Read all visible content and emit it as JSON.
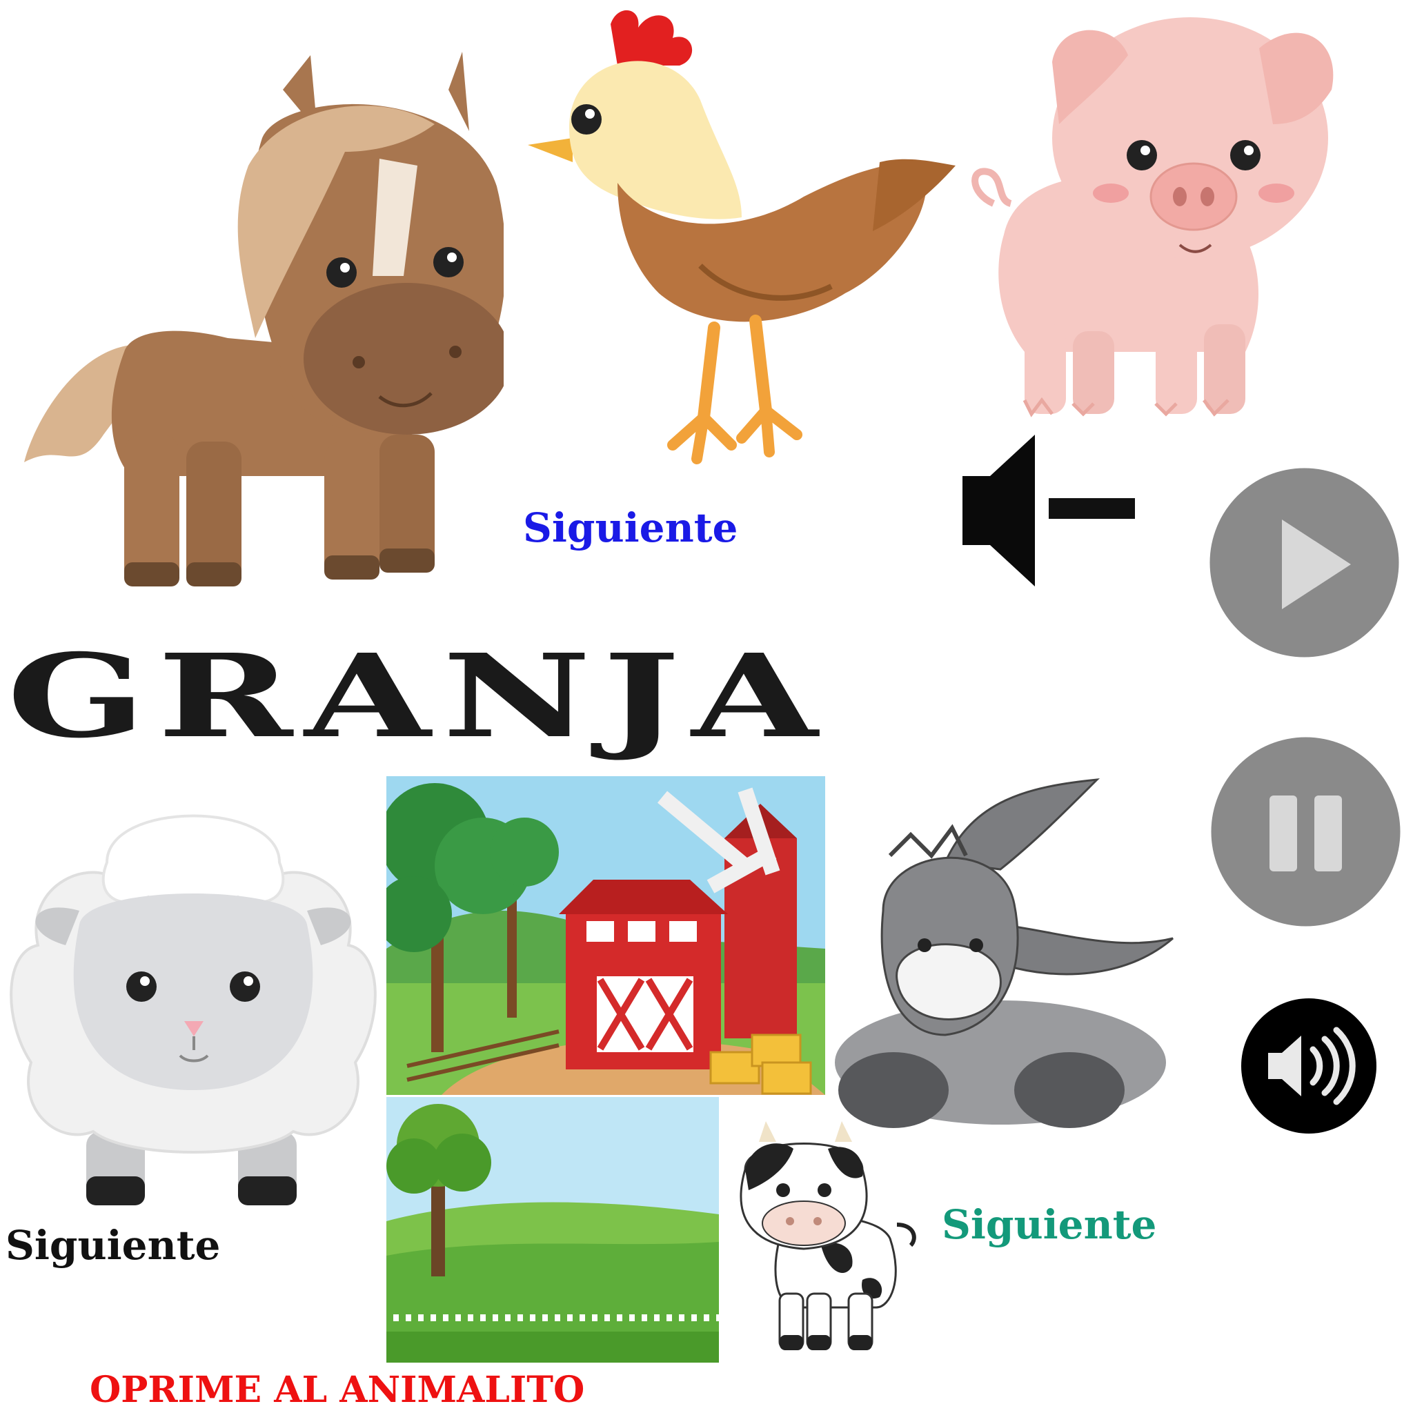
{
  "title": "GRANJA",
  "prompt": "OPRIME AL ANIMALITO",
  "next_buttons": {
    "hen": "Siguiente",
    "sheep": "Siguiente",
    "cow": "Siguiente"
  },
  "colors": {
    "next_hen": "#1a1ae6",
    "next_sheep": "#111111",
    "next_cow": "#13997a",
    "prompt": "#ee1111",
    "control_gray": "#8a8a8a"
  },
  "icons": {
    "mute": "speaker-minus-icon",
    "play": "play-icon",
    "pause": "pause-icon",
    "volume": "volume-icon"
  }
}
